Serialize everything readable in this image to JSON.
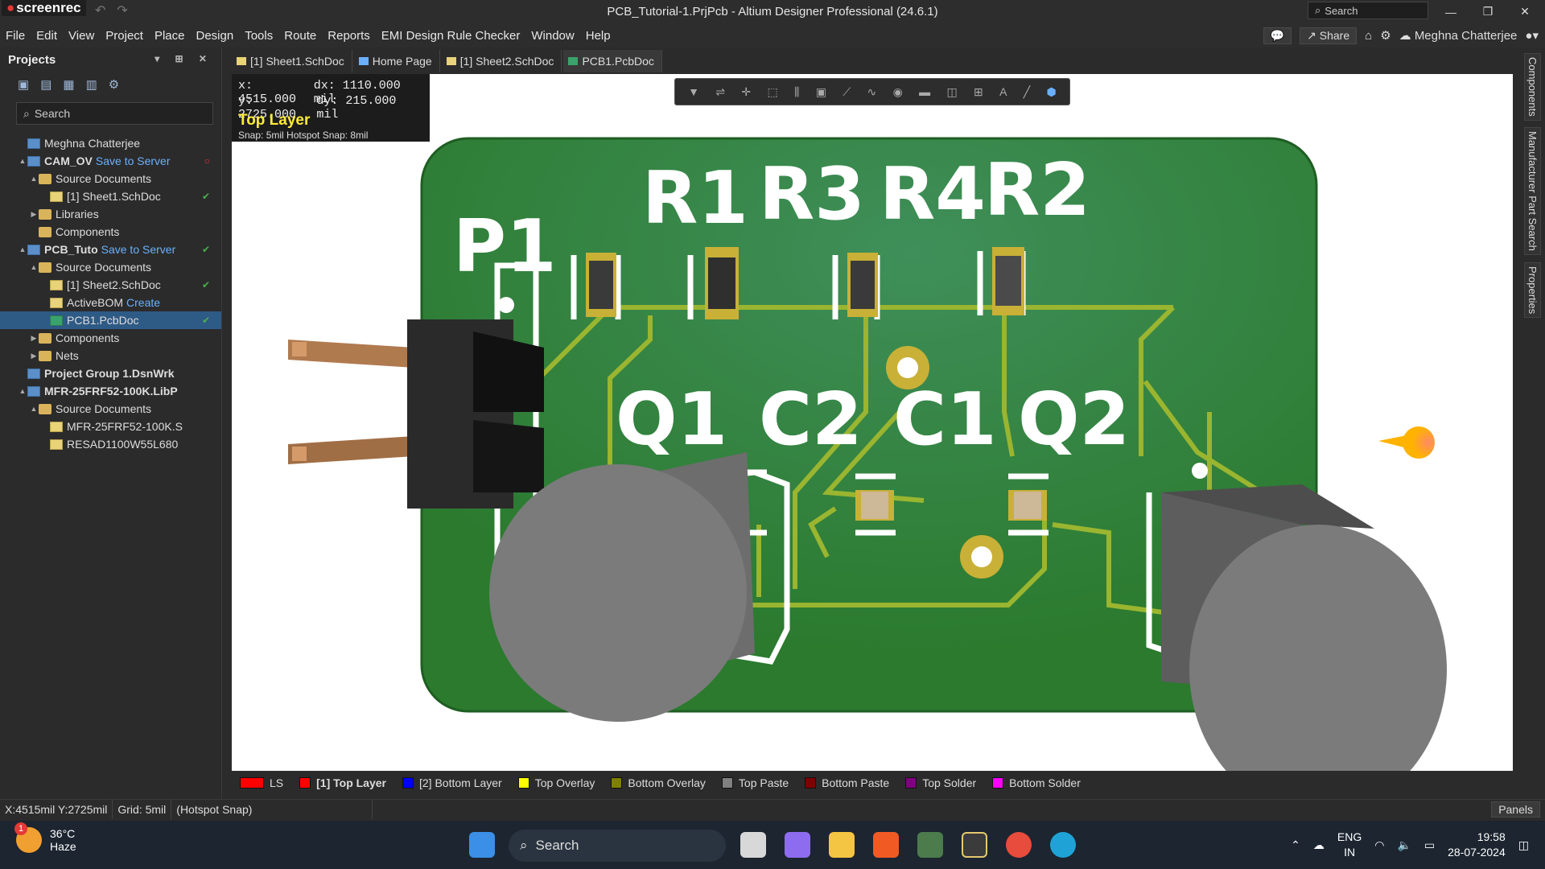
{
  "app": {
    "logo": "screenrec",
    "title": "PCB_Tutorial-1.PrjPcb - Altium Designer Professional (24.6.1)",
    "search_placeholder": "Search"
  },
  "menu": {
    "items": [
      "File",
      "Edit",
      "View",
      "Project",
      "Place",
      "Design",
      "Tools",
      "Route",
      "Reports",
      "EMI Design Rule Checker",
      "Window",
      "Help"
    ],
    "share": "Share",
    "user": "Meghna Chatterjee"
  },
  "projects_panel": {
    "title": "Projects",
    "search": "Search",
    "tree": [
      {
        "label": "Meghna Chatterjee",
        "indent": 0,
        "icon": "cloud-icon",
        "link": "",
        "arrow": ""
      },
      {
        "label": "CAM_OV",
        "indent": 0,
        "icon": "project-icon",
        "link": "Save to Server",
        "arrow": "▲",
        "bold": true,
        "status": "○"
      },
      {
        "label": "Source Documents",
        "indent": 1,
        "icon": "folder-icon",
        "link": "",
        "arrow": "▲"
      },
      {
        "label": "[1] Sheet1.SchDoc",
        "indent": 2,
        "icon": "doc-icon",
        "link": "",
        "arrow": "",
        "status": "✔"
      },
      {
        "label": "Libraries",
        "indent": 1,
        "icon": "folder-icon",
        "link": "",
        "arrow": "▶"
      },
      {
        "label": "Components",
        "indent": 1,
        "icon": "folder-icon",
        "link": "",
        "arrow": ""
      },
      {
        "label": "PCB_Tuto",
        "indent": 0,
        "icon": "project-icon",
        "link": "Save to Server",
        "arrow": "▲",
        "bold": true,
        "status": "✔"
      },
      {
        "label": "Source Documents",
        "indent": 1,
        "icon": "folder-icon",
        "link": "",
        "arrow": "▲"
      },
      {
        "label": "[1] Sheet2.SchDoc",
        "indent": 2,
        "icon": "doc-icon",
        "link": "",
        "arrow": "",
        "status": "✔"
      },
      {
        "label": "ActiveBOM",
        "indent": 2,
        "icon": "doc-icon",
        "link": "Create",
        "arrow": ""
      },
      {
        "label": "PCB1.PcbDoc",
        "indent": 2,
        "icon": "pcb-icon",
        "link": "",
        "arrow": "",
        "selected": true,
        "status": "✔"
      },
      {
        "label": "Components",
        "indent": 1,
        "icon": "folder-icon",
        "link": "",
        "arrow": "▶"
      },
      {
        "label": "Nets",
        "indent": 1,
        "icon": "folder-icon",
        "link": "",
        "arrow": "▶"
      },
      {
        "label": "Project Group 1.DsnWrk",
        "indent": 0,
        "icon": "project-icon",
        "link": "",
        "arrow": "",
        "bold": true
      },
      {
        "label": "MFR-25FRF52-100K.LibP",
        "indent": 0,
        "icon": "project-icon",
        "link": "",
        "arrow": "▲",
        "bold": true
      },
      {
        "label": "Source Documents",
        "indent": 1,
        "icon": "folder-icon",
        "link": "",
        "arrow": "▲"
      },
      {
        "label": "MFR-25FRF52-100K.S",
        "indent": 2,
        "icon": "doc-icon",
        "link": "",
        "arrow": ""
      },
      {
        "label": "RESAD1100W55L680",
        "indent": 2,
        "icon": "doc-icon",
        "link": "",
        "arrow": ""
      }
    ]
  },
  "tabs": [
    {
      "label": "[1] Sheet1.SchDoc",
      "icon": "doc-icon"
    },
    {
      "label": "Home Page",
      "icon": "home-icon"
    },
    {
      "label": "[1] Sheet2.SchDoc",
      "icon": "doc-icon"
    },
    {
      "label": "PCB1.PcbDoc",
      "icon": "pcb-icon",
      "active": true
    }
  ],
  "hud": {
    "x_label": "x:",
    "x": "4515.000",
    "dx_label": "dx:",
    "dx": "1110.000 mil",
    "y_label": "y:",
    "y": "2725.000",
    "dy_label": "dy:",
    "dy": "215.000  mil",
    "layer": "Top Layer",
    "snap": "Snap: 5mil Hotspot Snap: 8mil"
  },
  "pcb": {
    "designators": [
      "P1",
      "R1",
      "R3",
      "R4",
      "R2",
      "Q1",
      "C2",
      "C1",
      "Q2"
    ],
    "board_color": "#2e7d32",
    "silk_color": "#ffffff",
    "pad_color": "#c9b037"
  },
  "side_tabs": [
    "Components",
    "Manufacturer Part Search",
    "Properties"
  ],
  "layers": [
    {
      "label": "LS",
      "color": "#ff0000"
    },
    {
      "label": "[1] Top Layer",
      "color": "#ff0000",
      "current": true
    },
    {
      "label": "[2] Bottom Layer",
      "color": "#0000ff"
    },
    {
      "label": "Top Overlay",
      "color": "#ffff00"
    },
    {
      "label": "Bottom Overlay",
      "color": "#808000"
    },
    {
      "label": "Top Paste",
      "color": "#808080"
    },
    {
      "label": "Bottom Paste",
      "color": "#800000"
    },
    {
      "label": "Top Solder",
      "color": "#800080"
    },
    {
      "label": "Bottom Solder",
      "color": "#ff00ff"
    }
  ],
  "status": {
    "coords": "X:4515mil Y:2725mil",
    "grid": "Grid: 5mil",
    "snap": "(Hotspot Snap)",
    "panels": "Panels"
  },
  "taskbar": {
    "temp": "36°C",
    "weather": "Haze",
    "badge": "1",
    "search": "Search",
    "lang1": "ENG",
    "lang2": "IN",
    "time": "19:58",
    "date": "28-07-2024"
  }
}
